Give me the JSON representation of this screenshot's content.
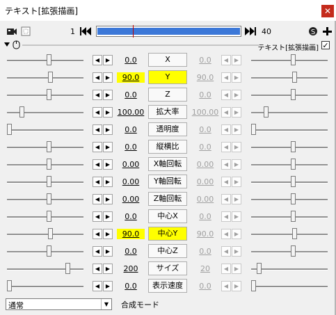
{
  "window": {
    "title": "テキスト[拡張描画]",
    "close_glyph": "✕"
  },
  "toolbar": {
    "frame_start": "1",
    "frame_end": "40",
    "timeline_position": 0.25
  },
  "object": {
    "title": "テキスト[拡張描画]",
    "visible_check": "✓"
  },
  "tracks": [
    {
      "name": "X",
      "start": "0.0",
      "end": "0.0",
      "left_pos": 0.55,
      "right_pos": 0.55,
      "highlight": false
    },
    {
      "name": "Y",
      "start": "90.0",
      "end": "90.0",
      "left_pos": 0.57,
      "right_pos": 0.57,
      "highlight": true
    },
    {
      "name": "Z",
      "start": "0.0",
      "end": "0.0",
      "left_pos": 0.55,
      "right_pos": 0.55,
      "highlight": false
    },
    {
      "name": "拡大率",
      "start": "100.00",
      "end": "100.00",
      "left_pos": 0.17,
      "right_pos": 0.17,
      "highlight": false
    },
    {
      "name": "透明度",
      "start": "0.0",
      "end": "0.0",
      "left_pos": 0.0,
      "right_pos": 0.0,
      "highlight": false
    },
    {
      "name": "縦横比",
      "start": "0.0",
      "end": "0.0",
      "left_pos": 0.55,
      "right_pos": 0.55,
      "highlight": false
    },
    {
      "name": "X軸回転",
      "start": "0.00",
      "end": "0.00",
      "left_pos": 0.55,
      "right_pos": 0.55,
      "highlight": false
    },
    {
      "name": "Y軸回転",
      "start": "0.00",
      "end": "0.00",
      "left_pos": 0.55,
      "right_pos": 0.55,
      "highlight": false
    },
    {
      "name": "Z軸回転",
      "start": "0.00",
      "end": "0.00",
      "left_pos": 0.55,
      "right_pos": 0.55,
      "highlight": false
    },
    {
      "name": "中心X",
      "start": "0.0",
      "end": "0.0",
      "left_pos": 0.55,
      "right_pos": 0.55,
      "highlight": false
    },
    {
      "name": "中心Y",
      "start": "90.0",
      "end": "90.0",
      "left_pos": 0.57,
      "right_pos": 0.57,
      "highlight": true
    },
    {
      "name": "中心Z",
      "start": "0.0",
      "end": "0.0",
      "left_pos": 0.55,
      "right_pos": 0.55,
      "highlight": false
    },
    {
      "name": "サイズ",
      "start": "200",
      "end": "20",
      "left_pos": 0.82,
      "right_pos": 0.08,
      "highlight": false
    },
    {
      "name": "表示速度",
      "start": "0.0",
      "end": "0.0",
      "left_pos": 0.0,
      "right_pos": 0.0,
      "highlight": false
    }
  ],
  "blend": {
    "value": "通常",
    "label": "合成モード"
  },
  "colors": {
    "highlight": "#ffff00",
    "timeline": "#3c78d8",
    "close": "#c42b1c"
  }
}
